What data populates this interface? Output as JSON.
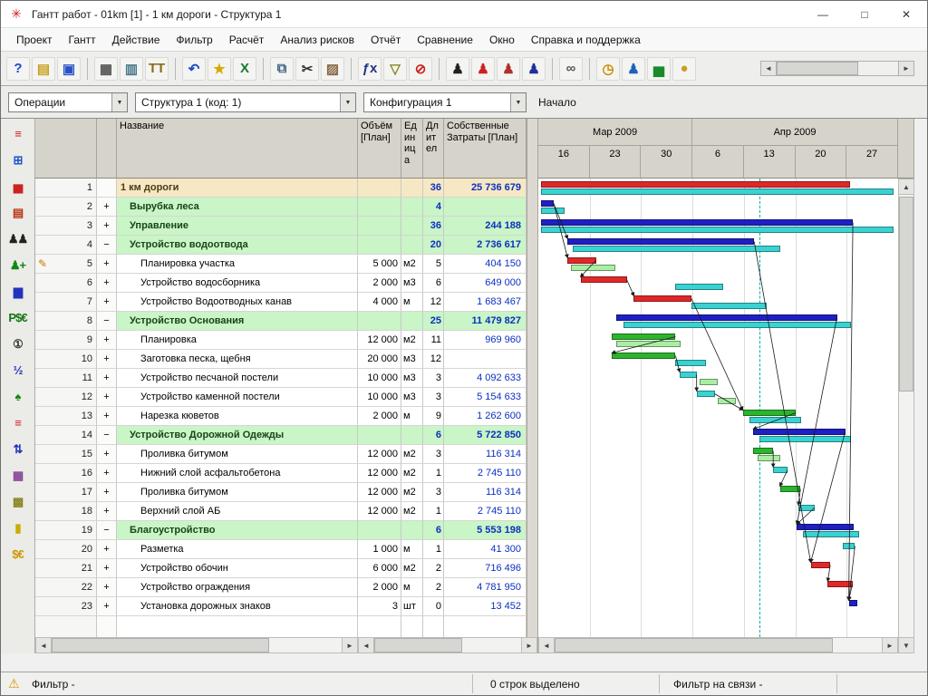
{
  "window": {
    "title": "Гантт работ - 01km [1] - 1 км дороги - Структура 1"
  },
  "icons": {
    "app": "✳",
    "minimize": "—",
    "maximize": "□",
    "close": "✕",
    "pencil": "✎",
    "warning": "⚠",
    "arrow_left": "◄",
    "arrow_right": "►",
    "arrow_up": "▲",
    "arrow_down": "▼",
    "combo_arrow": "▼"
  },
  "menu": {
    "items": [
      "Проект",
      "Гантт",
      "Действие",
      "Фильтр",
      "Расчёт",
      "Анализ рисков",
      "Отчёт",
      "Сравнение",
      "Окно",
      "Справка и поддержка"
    ]
  },
  "toolbar": {
    "groups": [
      [
        {
          "name": "help",
          "glyph": "?",
          "color": "#1a49c8"
        },
        {
          "name": "open",
          "glyph": "▤",
          "color": "#c8a020"
        },
        {
          "name": "save",
          "glyph": "▣",
          "color": "#2a52c8"
        }
      ],
      [
        {
          "name": "tables",
          "glyph": "▦",
          "color": "#555555"
        },
        {
          "name": "print",
          "glyph": "▥",
          "color": "#447788"
        },
        {
          "name": "columns-setup",
          "glyph": "ТТ",
          "color": "#8a6d1a"
        }
      ],
      [
        {
          "name": "undo",
          "glyph": "↶",
          "color": "#1a49c8"
        },
        {
          "name": "favorites",
          "glyph": "★",
          "color": "#d8a800"
        },
        {
          "name": "excel-export",
          "glyph": "Х",
          "color": "#1a7a2a"
        }
      ],
      [
        {
          "name": "copy",
          "glyph": "⧉",
          "color": "#446688"
        },
        {
          "name": "cut",
          "glyph": "✂",
          "color": "#333333"
        },
        {
          "name": "paste",
          "glyph": "▨",
          "color": "#886644"
        }
      ],
      [
        {
          "name": "formula",
          "glyph": "ƒx",
          "color": "#223388"
        },
        {
          "name": "filter",
          "glyph": "▽",
          "color": "#888822"
        },
        {
          "name": "cancel",
          "glyph": "⊘",
          "color": "#cc2222"
        }
      ],
      [
        {
          "name": "resource-work",
          "glyph": "♟",
          "color": "#222222"
        },
        {
          "name": "resource-critical",
          "glyph": "♟",
          "color": "#cc2222"
        },
        {
          "name": "resource-delay",
          "glyph": "♟",
          "color": "#b03030"
        },
        {
          "name": "resource-team",
          "glyph": "♟",
          "color": "#2030a0"
        }
      ],
      [
        {
          "name": "links",
          "glyph": "∞",
          "color": "#555555"
        }
      ],
      [
        {
          "name": "time-analysis",
          "glyph": "◷",
          "color": "#c89000"
        },
        {
          "name": "resource-analysis",
          "glyph": "♟",
          "color": "#2060c0"
        },
        {
          "name": "histogram",
          "glyph": "▅",
          "color": "#1a8a2a"
        },
        {
          "name": "cost-analysis",
          "glyph": "●",
          "color": "#c8a020"
        }
      ]
    ]
  },
  "filters": {
    "view": "Операции",
    "structure": "Структура 1 (код: 1)",
    "configuration": "Конфигурация 1",
    "start_label": "Начало"
  },
  "left_toolbar": [
    {
      "name": "gantt-chart-view",
      "glyph": "≡",
      "color": "#cc2222"
    },
    {
      "name": "network-diagram-view",
      "glyph": "⊞",
      "color": "#2255cc"
    },
    {
      "name": "resource-gantt-view",
      "glyph": "▅",
      "color": "#cc2222"
    },
    {
      "name": "materials-view",
      "glyph": "▤",
      "color": "#bb3311"
    },
    {
      "name": "resources-view",
      "glyph": "♟♟",
      "color": "#222222"
    },
    {
      "name": "add-resource",
      "glyph": "♟+",
      "color": "#118811"
    },
    {
      "name": "cost-chart-view",
      "glyph": "▆",
      "color": "#2233bb"
    },
    {
      "name": "currency-view",
      "glyph": "P$€",
      "color": "#117711"
    },
    {
      "name": "document-1-view",
      "glyph": "①",
      "color": "#333333"
    },
    {
      "name": "document-half-view",
      "glyph": "½",
      "color": "#2233bb"
    },
    {
      "name": "tree-view",
      "glyph": "♠",
      "color": "#118811"
    },
    {
      "name": "blocks-view",
      "glyph": "≡",
      "color": "#cc2222"
    },
    {
      "name": "exchange-view",
      "glyph": "⇅",
      "color": "#2233bb"
    },
    {
      "name": "calendar-view",
      "glyph": "▦",
      "color": "#884499"
    },
    {
      "name": "pattern-view",
      "glyph": "▩",
      "color": "#888822"
    },
    {
      "name": "battery-view",
      "glyph": "▮",
      "color": "#ccaa00"
    },
    {
      "name": "coins-view",
      "glyph": "$€",
      "color": "#cc9900"
    }
  ],
  "table": {
    "headers": {
      "name": "Название",
      "volume": "Объём [План]",
      "unit": "Единица",
      "duration": "Длител",
      "cost": "Собственные Затраты [План]"
    },
    "rows": [
      {
        "num": "1",
        "toggle": "",
        "name": "1 км дороги",
        "volume": "",
        "unit": "",
        "dur": "36",
        "cost": "25 736 679",
        "type": "root"
      },
      {
        "num": "2",
        "toggle": "+",
        "name": "Вырубка леса",
        "volume": "",
        "unit": "",
        "dur": "4",
        "cost": "",
        "type": "group"
      },
      {
        "num": "3",
        "toggle": "+",
        "name": "Управление",
        "volume": "",
        "unit": "",
        "dur": "36",
        "cost": "244 188",
        "type": "group"
      },
      {
        "num": "4",
        "toggle": "−",
        "name": "Устройство водоотвода",
        "volume": "",
        "unit": "",
        "dur": "20",
        "cost": "2 736 617",
        "type": "group"
      },
      {
        "num": "5",
        "toggle": "+",
        "name": "Планировка участка",
        "volume": "5 000",
        "unit": "м2",
        "dur": "5",
        "cost": "404 150",
        "type": "task",
        "marker": true
      },
      {
        "num": "6",
        "toggle": "+",
        "name": "Устройство водосборника",
        "volume": "2 000",
        "unit": "м3",
        "dur": "6",
        "cost": "649 000",
        "type": "task"
      },
      {
        "num": "7",
        "toggle": "+",
        "name": "Устройство Водоотводных канав",
        "volume": "4 000",
        "unit": "м",
        "dur": "12",
        "cost": "1 683 467",
        "type": "task"
      },
      {
        "num": "8",
        "toggle": "−",
        "name": "Устройство Основания",
        "volume": "",
        "unit": "",
        "dur": "25",
        "cost": "11 479 827",
        "type": "group"
      },
      {
        "num": "9",
        "toggle": "+",
        "name": "Планировка",
        "volume": "12 000",
        "unit": "м2",
        "dur": "11",
        "cost": "969 960",
        "type": "task"
      },
      {
        "num": "10",
        "toggle": "+",
        "name": "Заготовка песка, щебня",
        "volume": "20 000",
        "unit": "м3",
        "dur": "12",
        "cost": "",
        "type": "task"
      },
      {
        "num": "11",
        "toggle": "+",
        "name": "Устройство песчаной постели",
        "volume": "10 000",
        "unit": "м3",
        "dur": "3",
        "cost": "4 092 633",
        "type": "task"
      },
      {
        "num": "12",
        "toggle": "+",
        "name": "Устройство каменной постели",
        "volume": "10 000",
        "unit": "м3",
        "dur": "3",
        "cost": "5 154 633",
        "type": "task"
      },
      {
        "num": "13",
        "toggle": "+",
        "name": "Нарезка кюветов",
        "volume": "2 000",
        "unit": "м",
        "dur": "9",
        "cost": "1 262 600",
        "type": "task"
      },
      {
        "num": "14",
        "toggle": "−",
        "name": "Устройство Дорожной Одежды",
        "volume": "",
        "unit": "",
        "dur": "6",
        "cost": "5 722 850",
        "type": "group"
      },
      {
        "num": "15",
        "toggle": "+",
        "name": "Проливка битумом",
        "volume": "12 000",
        "unit": "м2",
        "dur": "3",
        "cost": "116 314",
        "type": "task"
      },
      {
        "num": "16",
        "toggle": "+",
        "name": "Нижний слой асфальтобетона",
        "volume": "12 000",
        "unit": "м2",
        "dur": "1",
        "cost": "2 745 110",
        "type": "task"
      },
      {
        "num": "17",
        "toggle": "+",
        "name": "Проливка битумом",
        "volume": "12 000",
        "unit": "м2",
        "dur": "3",
        "cost": "116 314",
        "type": "task"
      },
      {
        "num": "18",
        "toggle": "+",
        "name": "Верхний слой АБ",
        "volume": "12 000",
        "unit": "м2",
        "dur": "1",
        "cost": "2 745 110",
        "type": "task"
      },
      {
        "num": "19",
        "toggle": "−",
        "name": "Благоустройство",
        "volume": "",
        "unit": "",
        "dur": "6",
        "cost": "5 553 198",
        "type": "group"
      },
      {
        "num": "20",
        "toggle": "+",
        "name": "Разметка",
        "volume": "1 000",
        "unit": "м",
        "dur": "1",
        "cost": "41 300",
        "type": "task"
      },
      {
        "num": "21",
        "toggle": "+",
        "name": "Устройство обочин",
        "volume": "6 000",
        "unit": "м2",
        "dur": "2",
        "cost": "716 496",
        "type": "task"
      },
      {
        "num": "22",
        "toggle": "+",
        "name": "Устройство ограждения",
        "volume": "2 000",
        "unit": "м",
        "dur": "2",
        "cost": "4 781 950",
        "type": "task"
      },
      {
        "num": "23",
        "toggle": "+",
        "name": "Установка дорожных знаков",
        "volume": "3",
        "unit": "шт",
        "dur": "0",
        "cost": "13 452",
        "type": "task"
      }
    ]
  },
  "gantt": {
    "months": [
      {
        "label": "Мар 2009",
        "span": 3
      },
      {
        "label": "Апр 2009",
        "span": 4
      }
    ],
    "weeks": [
      "16",
      "23",
      "30",
      "6",
      "13",
      "20",
      "27"
    ],
    "colors": {
      "red": "#e02828",
      "navy": "#1f1fc4",
      "cyan": "#3ad2d2",
      "green": "#2cb42c",
      "lgreen": "#a9eea2"
    },
    "refline_week": 4.3,
    "bars": [
      {
        "row": 1,
        "x0": 0.05,
        "x1": 6.06,
        "color": "red",
        "lane": 0
      },
      {
        "row": 1,
        "x0": 0.05,
        "x1": 6.91,
        "color": "cyan",
        "lane": 1
      },
      {
        "row": 2,
        "x0": 0.05,
        "x1": 0.3,
        "color": "navy",
        "lane": 0
      },
      {
        "row": 2,
        "x0": 0.05,
        "x1": 0.52,
        "color": "cyan",
        "lane": 1
      },
      {
        "row": 3,
        "x0": 0.05,
        "x1": 6.12,
        "color": "navy",
        "lane": 0
      },
      {
        "row": 3,
        "x0": 0.05,
        "x1": 6.91,
        "color": "cyan",
        "lane": 1
      },
      {
        "row": 4,
        "x0": 0.57,
        "x1": 4.2,
        "color": "navy",
        "lane": 0
      },
      {
        "row": 4,
        "x0": 0.67,
        "x1": 4.7,
        "color": "cyan",
        "lane": 1
      },
      {
        "row": 5,
        "x0": 0.57,
        "x1": 1.12,
        "color": "red",
        "lane": 0
      },
      {
        "row": 5,
        "x0": 0.64,
        "x1": 1.5,
        "color": "lgreen",
        "lane": 1
      },
      {
        "row": 6,
        "x0": 0.82,
        "x1": 1.72,
        "color": "red",
        "lane": 0
      },
      {
        "row": 6,
        "x0": 2.66,
        "x1": 3.6,
        "color": "cyan",
        "lane": 1
      },
      {
        "row": 7,
        "x0": 1.86,
        "x1": 2.98,
        "color": "red",
        "lane": 0
      },
      {
        "row": 7,
        "x0": 2.98,
        "x1": 4.45,
        "color": "cyan",
        "lane": 1
      },
      {
        "row": 8,
        "x0": 1.52,
        "x1": 5.81,
        "color": "navy",
        "lane": 0
      },
      {
        "row": 8,
        "x0": 1.65,
        "x1": 6.08,
        "color": "cyan",
        "lane": 1
      },
      {
        "row": 9,
        "x0": 1.43,
        "x1": 2.67,
        "color": "green",
        "lane": 0
      },
      {
        "row": 9,
        "x0": 1.52,
        "x1": 2.77,
        "color": "lgreen",
        "lane": 1
      },
      {
        "row": 10,
        "x0": 1.43,
        "x1": 2.67,
        "color": "green",
        "lane": 0
      },
      {
        "row": 10,
        "x0": 2.67,
        "x1": 3.26,
        "color": "cyan",
        "lane": 1
      },
      {
        "row": 11,
        "x0": 2.75,
        "x1": 3.08,
        "color": "cyan",
        "lane": 0
      },
      {
        "row": 11,
        "x0": 3.13,
        "x1": 3.49,
        "color": "lgreen",
        "lane": 1
      },
      {
        "row": 12,
        "x0": 3.08,
        "x1": 3.43,
        "color": "cyan",
        "lane": 0
      },
      {
        "row": 12,
        "x0": 3.49,
        "x1": 3.84,
        "color": "lgreen",
        "lane": 1
      },
      {
        "row": 13,
        "x0": 3.98,
        "x1": 5.01,
        "color": "green",
        "lane": 0
      },
      {
        "row": 13,
        "x0": 4.1,
        "x1": 5.12,
        "color": "cyan",
        "lane": 1
      },
      {
        "row": 14,
        "x0": 4.18,
        "x1": 5.97,
        "color": "navy",
        "lane": 0
      },
      {
        "row": 14,
        "x0": 4.3,
        "x1": 6.08,
        "color": "cyan",
        "lane": 1
      },
      {
        "row": 15,
        "x0": 4.18,
        "x1": 4.57,
        "color": "green",
        "lane": 0
      },
      {
        "row": 15,
        "x0": 4.27,
        "x1": 4.7,
        "color": "lgreen",
        "lane": 1
      },
      {
        "row": 16,
        "x0": 4.57,
        "x1": 4.85,
        "color": "cyan",
        "lane": 0
      },
      {
        "row": 17,
        "x0": 4.7,
        "x1": 5.1,
        "color": "green",
        "lane": 0
      },
      {
        "row": 18,
        "x0": 5.06,
        "x1": 5.37,
        "color": "cyan",
        "lane": 0
      },
      {
        "row": 19,
        "x0": 5.03,
        "x1": 6.13,
        "color": "navy",
        "lane": 0
      },
      {
        "row": 19,
        "x0": 5.15,
        "x1": 6.25,
        "color": "cyan",
        "lane": 1
      },
      {
        "row": 20,
        "x0": 5.93,
        "x1": 6.16,
        "color": "cyan",
        "lane": 0
      },
      {
        "row": 21,
        "x0": 5.3,
        "x1": 5.68,
        "color": "red",
        "lane": 0
      },
      {
        "row": 22,
        "x0": 5.63,
        "x1": 6.11,
        "color": "red",
        "lane": 0
      },
      {
        "row": 23,
        "x0": 6.04,
        "x1": 6.2,
        "color": "navy",
        "lane": 0
      }
    ],
    "links": [
      [
        2,
        6
      ],
      [
        2,
        8
      ],
      [
        8,
        10
      ],
      [
        10,
        12
      ],
      [
        12,
        24
      ],
      [
        16,
        18
      ],
      [
        18,
        20
      ],
      [
        20,
        22
      ],
      [
        22,
        24
      ],
      [
        24,
        26
      ],
      [
        28,
        30
      ],
      [
        30,
        31
      ],
      [
        31,
        32
      ],
      [
        32,
        33
      ],
      [
        36,
        37
      ],
      [
        37,
        38
      ],
      [
        4,
        38
      ],
      [
        6,
        36
      ],
      [
        14,
        33
      ],
      [
        26,
        36
      ],
      [
        35,
        38
      ]
    ]
  },
  "statusbar": {
    "filter": "Фильтр -",
    "selected": "0 строк выделено",
    "links_filter": "Фильтр на связи -"
  }
}
